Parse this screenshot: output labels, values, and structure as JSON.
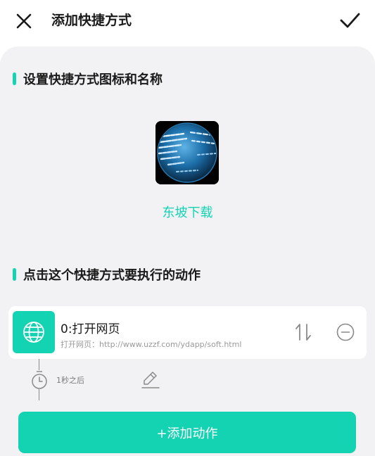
{
  "header": {
    "title": "添加快捷方式",
    "close_icon": "close-icon",
    "confirm_icon": "checkmark-icon"
  },
  "icon_section": {
    "heading": "设置快捷方式图标和名称",
    "icon": "globe-app-icon",
    "name": "东坡下载"
  },
  "action_section": {
    "heading": "点击这个快捷方式要执行的动作",
    "actions": [
      {
        "title": "0:打开网页",
        "subtitle": "打开网页：http://www.uzzf.com/ydapp/soft.html",
        "icon": "globe-icon",
        "reorder_icon": "reorder-arrows-icon",
        "remove_icon": "remove-circle-icon"
      }
    ],
    "delay_text": "1秒之后",
    "delay_icon": "stopwatch-icon",
    "edit_icon": "edit-pencil-icon"
  },
  "add_button": {
    "label": "+添加动作"
  },
  "colors": {
    "accent": "#14d3b2",
    "sheet_background": "#f2f2f4",
    "card_background": "#ffffff",
    "title_text": "#1a1a1a",
    "muted_text": "#9a9a9a"
  }
}
